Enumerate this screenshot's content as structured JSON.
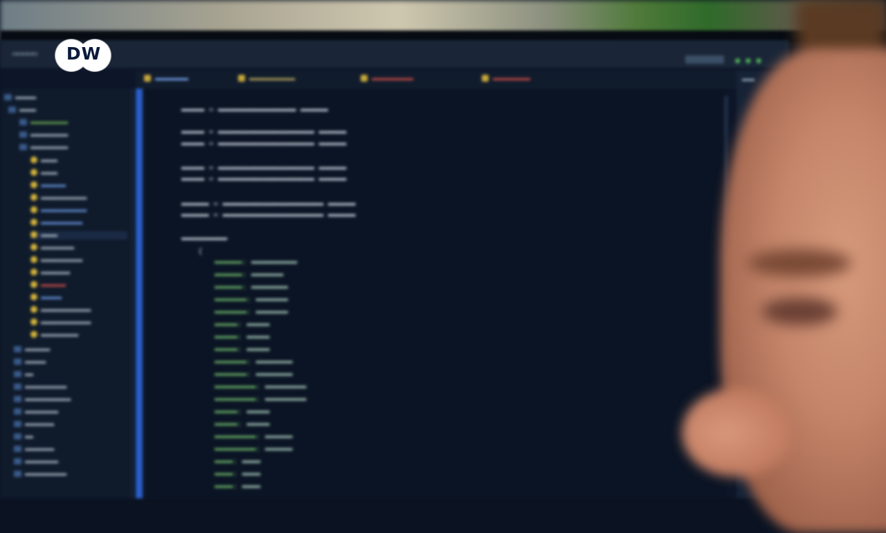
{
  "logo": {
    "text": "DW",
    "bg_color": "#ffffff",
    "fg_color": "#0a1a3a"
  },
  "ide": {
    "accent_color": "#2a5ec8",
    "theme": "dark"
  },
  "scene": {
    "subject": "person in profile in front of blurred code editor"
  }
}
